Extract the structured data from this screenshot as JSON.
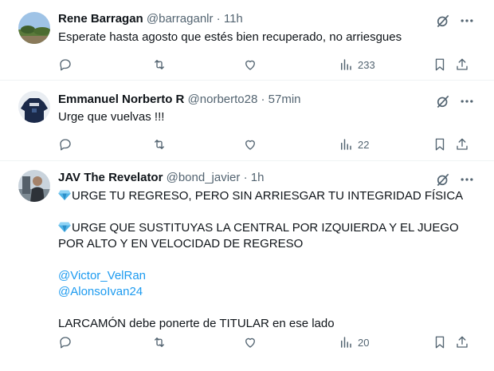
{
  "tweets": [
    {
      "name": "Rene Barragan",
      "handle": "@barraganlr",
      "dot": "·",
      "time": "11h",
      "paragraphs": [
        "Esperate  hasta agosto que estés bien recuperado, no arriesgues"
      ],
      "views": "233"
    },
    {
      "name": "Emmanuel Norberto R",
      "handle": "@norberto28",
      "dot": "·",
      "time": "57min",
      "paragraphs": [
        "Urge que vuelvas !!!"
      ],
      "views": "22"
    },
    {
      "name": "JAV The Revelator",
      "handle": "@bond_javier",
      "dot": "·",
      "time": "1h",
      "p1": "URGE TU REGRESO, PERO SIN ARRIESGAR TU INTEGRIDAD FÍSICA",
      "p2": "URGE QUE SUSTITUYAS LA CENTRAL POR IZQUIERDA Y EL JUEGO POR ALTO Y EN VELOCIDAD DE REGRESO",
      "mentions": [
        "@Victor_VelRan",
        "@AlonsoIvan24"
      ],
      "p4": "LARCAMÓN debe ponerte de TITULAR en ese lado",
      "views": "20"
    }
  ],
  "colors": {
    "text": "#0f1419",
    "muted": "#536471",
    "link": "#1d9bf0",
    "divider": "#eff3f4"
  },
  "icons": [
    "grok-icon",
    "more-icon",
    "reply-icon",
    "retweet-icon",
    "like-icon",
    "views-icon",
    "bookmark-icon",
    "share-icon",
    "diamond-icon"
  ]
}
